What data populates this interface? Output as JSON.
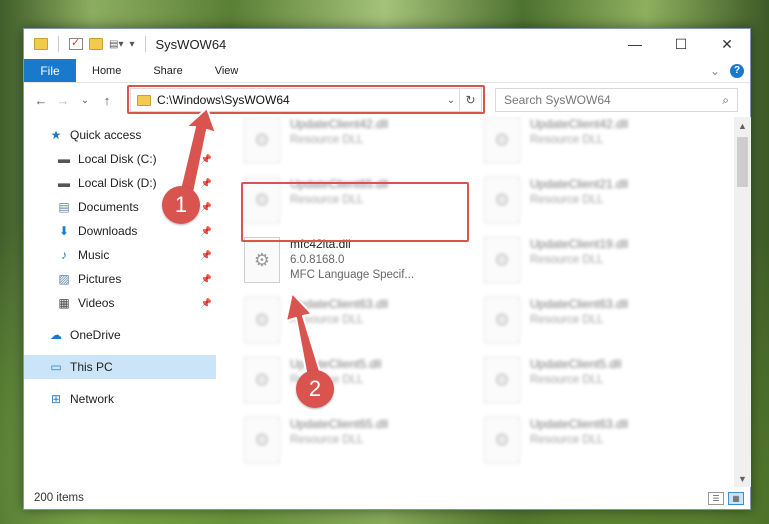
{
  "window": {
    "title": "SysWOW64",
    "controls": {
      "minimize": "—",
      "maximize": "☐",
      "close": "✕"
    }
  },
  "ribbon": {
    "file_tab": "File",
    "tabs": [
      "Home",
      "Share",
      "View"
    ],
    "expand": "⌄",
    "help": "?"
  },
  "nav": {
    "back": "←",
    "forward": "→",
    "recent": "⌄",
    "up": "↑",
    "address": "C:\\Windows\\SysWOW64",
    "address_dropdown": "⌄",
    "refresh": "↻",
    "search_placeholder": "Search SysWOW64",
    "search_icon": "⌕"
  },
  "sidebar": {
    "items": [
      {
        "label": "Quick access",
        "icon": "star-icon",
        "glyph": "★",
        "color": "#1979ca",
        "pinned": false,
        "selected": false
      },
      {
        "label": "Local Disk (C:)",
        "icon": "drive-icon",
        "glyph": "▬",
        "color": "#555555",
        "pinned": true,
        "selected": false
      },
      {
        "label": "Local Disk (D:)",
        "icon": "drive-icon",
        "glyph": "▬",
        "color": "#555555",
        "pinned": true,
        "selected": false
      },
      {
        "label": "Documents",
        "icon": "documents-icon",
        "glyph": "▤",
        "color": "#5a7fa6",
        "pinned": true,
        "selected": false
      },
      {
        "label": "Downloads",
        "icon": "download-icon",
        "glyph": "⬇",
        "color": "#1979ca",
        "pinned": true,
        "selected": false
      },
      {
        "label": "Music",
        "icon": "music-icon",
        "glyph": "♪",
        "color": "#1979ca",
        "pinned": true,
        "selected": false
      },
      {
        "label": "Pictures",
        "icon": "pictures-icon",
        "glyph": "▨",
        "color": "#5a7fa6",
        "pinned": true,
        "selected": false
      },
      {
        "label": "Videos",
        "icon": "videos-icon",
        "glyph": "▦",
        "color": "#444444",
        "pinned": true,
        "selected": false
      },
      {
        "label": "OneDrive",
        "icon": "cloud-icon",
        "glyph": "☁",
        "color": "#1979ca",
        "pinned": false,
        "selected": false
      },
      {
        "label": "This PC",
        "icon": "computer-icon",
        "glyph": "▭",
        "color": "#2a7fc9",
        "pinned": false,
        "selected": true
      },
      {
        "label": "Network",
        "icon": "network-icon",
        "glyph": "⊞",
        "color": "#2a7fc9",
        "pinned": false,
        "selected": false
      }
    ],
    "pin_glyph": "📌"
  },
  "files": {
    "left": [
      {
        "name": "UpdateClient42.dll",
        "sub": "Resource DLL",
        "blurred": true
      },
      {
        "name": "UpdateClient65.dll",
        "sub": "Resource DLL",
        "blurred": true
      },
      {
        "name": "mfc42ita.dll",
        "sub": "6.0.8168.0",
        "sub2": "MFC Language Specif...",
        "blurred": false
      },
      {
        "name": "UpdateClient63.dll",
        "sub": "Resource DLL",
        "blurred": true
      },
      {
        "name": "UpdateClient5.dll",
        "sub": "Resource DLL",
        "blurred": true
      },
      {
        "name": "UpdateClient65.dll",
        "sub": "Resource DLL",
        "blurred": true
      }
    ],
    "right": [
      {
        "name": "UpdateClient42.dll",
        "sub": "Resource DLL",
        "blurred": true
      },
      {
        "name": "UpdateClient21.dll",
        "sub": "Resource DLL",
        "blurred": true
      },
      {
        "name": "UpdateClient19.dll",
        "sub": "Resource DLL",
        "blurred": true
      },
      {
        "name": "UpdateClient63.dll",
        "sub": "Resource DLL",
        "blurred": true
      },
      {
        "name": "UpdateClient5.dll",
        "sub": "Resource DLL",
        "blurred": true
      },
      {
        "name": "UpdateClient63.dll",
        "sub": "Resource DLL",
        "blurred": true
      }
    ],
    "file_icon": "⚙"
  },
  "status": {
    "count": "200 items",
    "view_details": "☰",
    "view_icons": "▦"
  },
  "callouts": [
    {
      "number": "1",
      "color": "#d9534f"
    },
    {
      "number": "2",
      "color": "#d9534f"
    }
  ]
}
